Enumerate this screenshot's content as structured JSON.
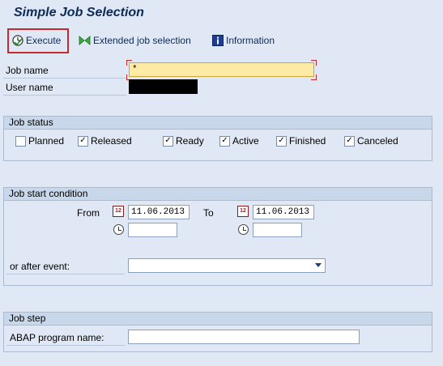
{
  "app": {
    "title": "Simple Job Selection"
  },
  "toolbar": {
    "execute_label": "Execute",
    "extended_label": "Extended job selection",
    "information_label": "Information"
  },
  "fields": {
    "job_name_label": "Job name",
    "job_name_value": "*",
    "user_name_label": "User name",
    "user_name_value": ""
  },
  "job_status": {
    "title": "Job status",
    "options": [
      {
        "label": "Planned",
        "checked": false
      },
      {
        "label": "Released",
        "checked": true
      },
      {
        "label": "Ready",
        "checked": true
      },
      {
        "label": "Active",
        "checked": true
      },
      {
        "label": "Finished",
        "checked": true
      },
      {
        "label": "Canceled",
        "checked": true
      }
    ]
  },
  "start_condition": {
    "title": "Job start condition",
    "from_label": "From",
    "from_date": "11.06.2013",
    "from_time": "",
    "to_label": "To",
    "to_date": "11.06.2013",
    "to_time": "",
    "event_label": "or after event:",
    "event_value": ""
  },
  "job_step": {
    "title": "Job step",
    "program_label": "ABAP program name:",
    "program_value": ""
  },
  "icons": {
    "execute": "clock-check-icon",
    "extended": "bowtie-icon",
    "information": "info-icon",
    "calendar": "calendar-icon",
    "clock": "clock-icon"
  }
}
